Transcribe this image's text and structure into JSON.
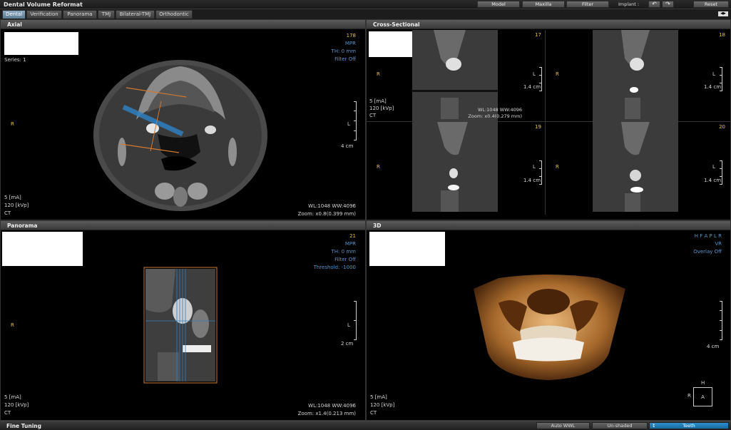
{
  "app": {
    "title": "Dental Volume Reformat"
  },
  "toolbar": {
    "buttons": [
      {
        "label": "Model"
      },
      {
        "label": "Maxilla"
      },
      {
        "label": "Filter"
      }
    ],
    "implant_label": "Implant :",
    "reset_label": "Reset"
  },
  "tabs": [
    {
      "label": "Dental",
      "active": true
    },
    {
      "label": "Verification"
    },
    {
      "label": "Panorama"
    },
    {
      "label": "TMJ"
    },
    {
      "label": "Bilateral-TMJ"
    },
    {
      "label": "Orthodontic"
    }
  ],
  "axial": {
    "title": "Axial",
    "series": "Series: 1",
    "slice": "178",
    "mode": "MPR",
    "th": "TH: 0 mm",
    "filter": "Filter Off",
    "orient_left": "R",
    "orient_right": "L",
    "scale": "4 cm",
    "ma": "5 [mA]",
    "kvp": "120 [kVp]",
    "modality": "CT",
    "wlww": "WL:1048 WW:4096",
    "zoom": "Zoom: x0.8(0.399 mm)"
  },
  "cross": {
    "title": "Cross-Sectional",
    "cells": [
      {
        "slice": "17",
        "r": "R",
        "l": "L",
        "scale": "1.4 cm"
      },
      {
        "slice": "18",
        "r": "R",
        "l": "L",
        "scale": "1.4 cm"
      },
      {
        "slice": "19",
        "r": "R",
        "l": "L",
        "scale": "1.4 cm"
      },
      {
        "slice": "20",
        "r": "R",
        "l": "L",
        "scale": "1.4 cm"
      }
    ],
    "ma": "5 [mA]",
    "kvp": "120 [kVp]",
    "modality": "CT",
    "wlww": "WL:1048 WW:4096",
    "zoom": "Zoom: x0.4(0.279 mm)"
  },
  "panorama": {
    "title": "Panorama",
    "slice": "21",
    "mode": "MPR",
    "th": "TH: 0 mm",
    "filter": "Filter Off",
    "threshold": "Threshold: -1000",
    "orient_left": "R",
    "orient_right": "L",
    "scale": "2 cm",
    "ma": "5 [mA]",
    "kvp": "120 [kVp]",
    "modality": "CT",
    "wlww": "WL:1048 WW:4096",
    "zoom": "Zoom: x1.4(0.213 mm)"
  },
  "view3d": {
    "title": "3D",
    "orient": "H F A P L R",
    "mode": "VR",
    "overlay": "Overlay Off",
    "scale": "4 cm",
    "ma": "5 [mA]",
    "kvp": "120 [kVp]",
    "modality": "CT",
    "cube_top": "H",
    "cube_left": "R",
    "cube_face": "A"
  },
  "bottom": {
    "title": "Fine Tuning",
    "buttons": [
      {
        "label": "Auto WWL"
      },
      {
        "label": "Un-shaded"
      },
      {
        "label": "Teeth"
      }
    ]
  }
}
